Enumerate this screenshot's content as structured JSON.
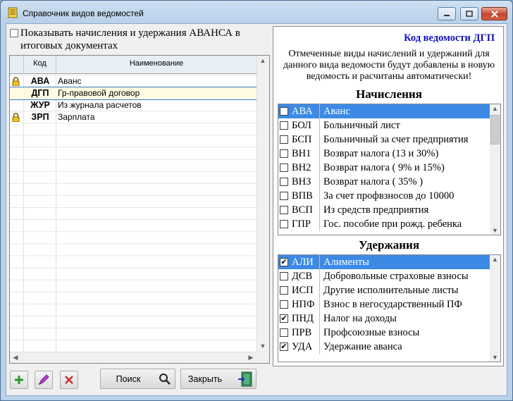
{
  "window": {
    "title": "Справочник видов ведомостей"
  },
  "left": {
    "show_advance_label": "Показывать начисления и удержания АВАНСА в итоговых документах",
    "show_advance_checked": false,
    "columns": {
      "code": "Код",
      "name": "Наименование"
    },
    "rows": [
      {
        "code": "АВА",
        "name": "Аванс",
        "locked": true,
        "selected": false
      },
      {
        "code": "ДГП",
        "name": "Гр-правовой договор",
        "locked": false,
        "selected": true
      },
      {
        "code": "ЖУР",
        "name": "Из журнала расчетов",
        "locked": false,
        "selected": false
      },
      {
        "code": "ЗРП",
        "name": "Зарплата",
        "locked": true,
        "selected": false
      }
    ]
  },
  "toolbar": {
    "add_icon": "plus-icon",
    "edit_icon": "pencil-icon",
    "delete_icon": "x-icon",
    "search_label": "Поиск",
    "close_label": "Закрыть"
  },
  "right": {
    "code_title": "Код ведомости ДГП",
    "note": "Отмеченные виды начислений и удержаний для данного вида ведомости будут добавлены в новую ведомость и расчитаны автоматически!",
    "accruals_heading": "Начисления",
    "accruals": [
      {
        "code": "АВА",
        "name": "Аванс",
        "checked": false,
        "selected": true
      },
      {
        "code": "БОЛ",
        "name": "Больничный лист",
        "checked": false,
        "selected": false
      },
      {
        "code": "БСП",
        "name": "Больничный за счет предприятия",
        "checked": false,
        "selected": false
      },
      {
        "code": "ВН1",
        "name": "Возврат налога (13 и 30%)",
        "checked": false,
        "selected": false
      },
      {
        "code": "ВН2",
        "name": "Возврат налога ( 9% и 15%)",
        "checked": false,
        "selected": false
      },
      {
        "code": "ВН3",
        "name": "Возврат налога ( 35% )",
        "checked": false,
        "selected": false
      },
      {
        "code": "ВПВ",
        "name": "За счет профвзносов до 10000",
        "checked": false,
        "selected": false
      },
      {
        "code": "ВСП",
        "name": "Из средств предприятия",
        "checked": false,
        "selected": false
      },
      {
        "code": "ГПР",
        "name": "Гос. пособие при рожд. ребенка",
        "checked": false,
        "selected": false
      }
    ],
    "deductions_heading": "Удержания",
    "deductions": [
      {
        "code": "АЛИ",
        "name": "Алименты",
        "checked": true,
        "selected": true
      },
      {
        "code": "ДСВ",
        "name": "Добровольные страховые взносы",
        "checked": false,
        "selected": false
      },
      {
        "code": "ИСП",
        "name": "Другие исполнительные листы",
        "checked": false,
        "selected": false
      },
      {
        "code": "НПФ",
        "name": "Взнос в негосударственный ПФ",
        "checked": false,
        "selected": false
      },
      {
        "code": "ПНД",
        "name": "Налог на доходы",
        "checked": true,
        "selected": false
      },
      {
        "code": "ПРВ",
        "name": "Профсоюзные взносы",
        "checked": false,
        "selected": false
      },
      {
        "code": "УДА",
        "name": "Удержание аванса",
        "checked": true,
        "selected": false
      }
    ]
  }
}
